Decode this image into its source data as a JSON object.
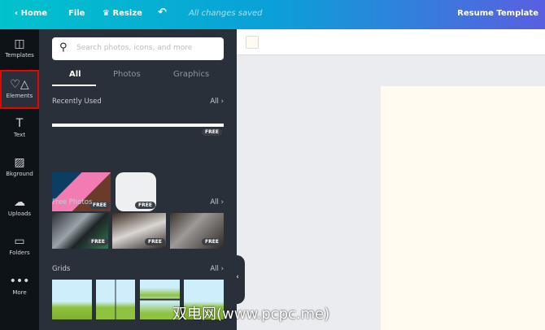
{
  "topbar": {
    "home": "Home",
    "file": "File",
    "resize": "Resize",
    "status": "All changes saved",
    "title": "Resume Template"
  },
  "nav": [
    {
      "label": "Templates"
    },
    {
      "label": "Elements"
    },
    {
      "label": "Text"
    },
    {
      "label": "Bkground"
    },
    {
      "label": "Uploads"
    },
    {
      "label": "Folders"
    },
    {
      "label": "More"
    }
  ],
  "search": {
    "placeholder": "Search photos, icons, and more"
  },
  "tabs": [
    "All",
    "Photos",
    "Graphics"
  ],
  "sections": {
    "recent": "Recently Used",
    "photos": "Free Photos",
    "grids": "Grids",
    "all": "All"
  },
  "badge": "FREE",
  "watermark": "双电网(www.pcpc.me)",
  "colors": {
    "accent": "#00c4cc",
    "selection": "#e00000"
  }
}
